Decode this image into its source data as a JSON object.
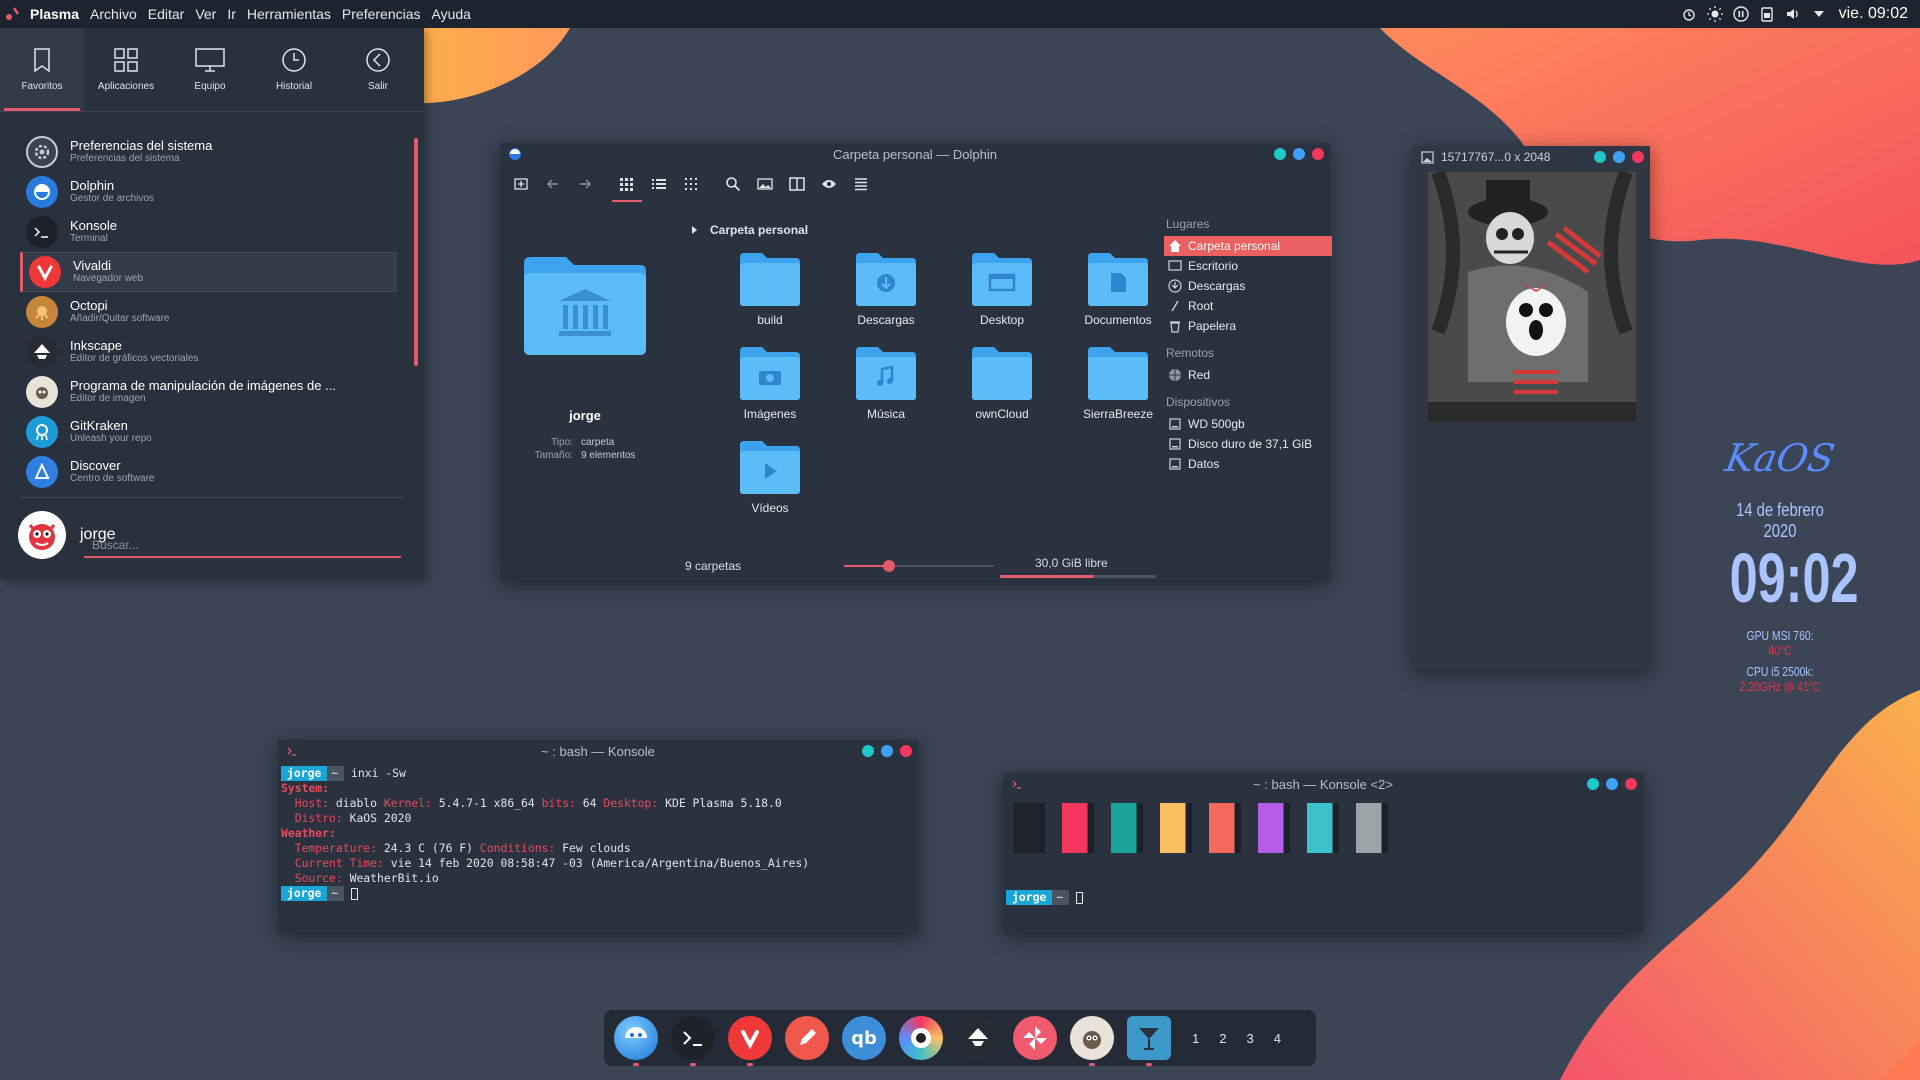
{
  "topbar": {
    "menus": [
      "Plasma",
      "Archivo",
      "Editar",
      "Ver",
      "Ir",
      "Herramientas",
      "Preferencias",
      "Ayuda"
    ],
    "clock": "vie. 09:02",
    "tray_icons": [
      "alarm-icon",
      "brightness-icon",
      "media-pause-icon",
      "clipboard-icon",
      "volume-icon",
      "chevron-down-icon"
    ]
  },
  "launcher": {
    "tabs": [
      {
        "label": "Favoritos",
        "icon": "bookmark-icon"
      },
      {
        "label": "Aplicaciones",
        "icon": "grid-icon"
      },
      {
        "label": "Equipo",
        "icon": "monitor-icon"
      },
      {
        "label": "Historial",
        "icon": "clock-icon"
      },
      {
        "label": "Salir",
        "icon": "back-arrow-icon"
      }
    ],
    "items": [
      {
        "name": "Preferencias del sistema",
        "desc": "Preferencias del sistema",
        "color": "#3b4250"
      },
      {
        "name": "Dolphin",
        "desc": "Gestor de archivos",
        "color": "#2a7be0"
      },
      {
        "name": "Konsole",
        "desc": "Terminal",
        "color": "#20262f"
      },
      {
        "name": "Vivaldi",
        "desc": "Navegador web",
        "color": "#ef3939"
      },
      {
        "name": "Octopi",
        "desc": "Añadir/Quitar software",
        "color": "#c6863a"
      },
      {
        "name": "Inkscape",
        "desc": "Editor de gráficos vectoriales",
        "color": "#262b34"
      },
      {
        "name": "Programa de manipulación de imágenes de ...",
        "desc": "Editor de imagen",
        "color": "#e8e2d8"
      },
      {
        "name": "GitKraken",
        "desc": "Unleash your repo",
        "color": "#1c9bd6"
      },
      {
        "name": "Discover",
        "desc": "Centro de software",
        "color": "#2f7ee0"
      }
    ],
    "user": "jorge",
    "search_placeholder": "Buscar..."
  },
  "dolphin": {
    "title": "Carpeta personal — Dolphin",
    "breadcrumb": "Carpeta personal",
    "folder_name": "jorge",
    "meta": {
      "type_label": "Tipo:",
      "type": "carpeta",
      "size_label": "Tamaño:",
      "size": "9 elementos"
    },
    "folders": [
      {
        "name": "build",
        "glyph": ""
      },
      {
        "name": "Descargas",
        "glyph": "download"
      },
      {
        "name": "Desktop",
        "glyph": "desktop"
      },
      {
        "name": "Documentos",
        "glyph": "doc"
      },
      {
        "name": "Imágenes",
        "glyph": "camera"
      },
      {
        "name": "Música",
        "glyph": "music"
      },
      {
        "name": "ownCloud",
        "glyph": ""
      },
      {
        "name": "SierraBreeze",
        "glyph": ""
      },
      {
        "name": "Vídeos",
        "glyph": "play"
      }
    ],
    "places": {
      "heading": "Lugares",
      "items": [
        "Carpeta personal",
        "Escritorio",
        "Descargas",
        "Root",
        "Papelera"
      ],
      "remote_heading": "Remotos",
      "remote": [
        "Red"
      ],
      "devices_heading": "Dispositivos",
      "devices": [
        "WD 500gb",
        "Disco duro de 37,1 GiB",
        "Datos"
      ]
    },
    "status_left": "9 carpetas",
    "zoom_level": 0.3,
    "free_space": "30,0 GiB libre",
    "free_fraction": 0.6
  },
  "image_viewer": {
    "title": "15717767...0 x 2048"
  },
  "konsole1": {
    "title": "~ : bash — Konsole",
    "prompt_user": "jorge",
    "prompt_dir": "~",
    "command": "inxi -Sw",
    "lines": [
      [
        [
          "k",
          "System:"
        ]
      ],
      [
        [
          "n",
          "  "
        ],
        [
          "k",
          "Host:"
        ],
        [
          "n",
          " diablo "
        ],
        [
          "k",
          "Kernel:"
        ],
        [
          "n",
          " 5.4.7-1 x86_64 "
        ],
        [
          "k",
          "bits:"
        ],
        [
          "n",
          " 64 "
        ],
        [
          "k",
          "Desktop:"
        ],
        [
          "n",
          " KDE Plasma 5.18.0"
        ]
      ],
      [
        [
          "n",
          "  "
        ],
        [
          "k",
          "Distro:"
        ],
        [
          "n",
          " KaOS 2020"
        ]
      ],
      [
        [
          "k",
          "Weather:"
        ]
      ],
      [
        [
          "n",
          "  "
        ],
        [
          "k",
          "Temperature:"
        ],
        [
          "n",
          " 24.3 C (76 F) "
        ],
        [
          "k",
          "Conditions:"
        ],
        [
          "n",
          " Few clouds"
        ]
      ],
      [
        [
          "n",
          "  "
        ],
        [
          "k",
          "Current Time:"
        ],
        [
          "n",
          " vie 14 feb 2020 08:58:47 -03 (America/Argentina/Buenos_Aires)"
        ]
      ],
      [
        [
          "n",
          "  "
        ],
        [
          "k",
          "Source:"
        ],
        [
          "n",
          " WeatherBit.io"
        ]
      ]
    ]
  },
  "konsole2": {
    "title": "~ : bash — Konsole <2>",
    "prompt_user": "jorge",
    "prompt_dir": "~",
    "swatches": [
      "#1f242c",
      "#f5375e",
      "#1aa39a",
      "#fbc062",
      "#f46b5d",
      "#b45ee8",
      "#3fc1c9",
      "#9aa5a8"
    ]
  },
  "desktop_widget": {
    "logo": "KaOS",
    "date": "14 de febrero 2020",
    "time": "09:02",
    "gpu_label": "GPU MSI 760:",
    "gpu_value": "40°C",
    "cpu_label": "CPU i5 2500k:",
    "cpu_value": "2,20GHz @ 41°C"
  },
  "dock": {
    "apps": [
      "dolphin-icon",
      "konsole-icon",
      "vivaldi-icon",
      "kate-icon",
      "qbittorrent-icon",
      "camera-icon",
      "inkscape-icon",
      "kaos-pinwheel-icon",
      "gimp-icon",
      "cocktail-icon"
    ],
    "pager": [
      "1",
      "2",
      "3",
      "4"
    ]
  }
}
